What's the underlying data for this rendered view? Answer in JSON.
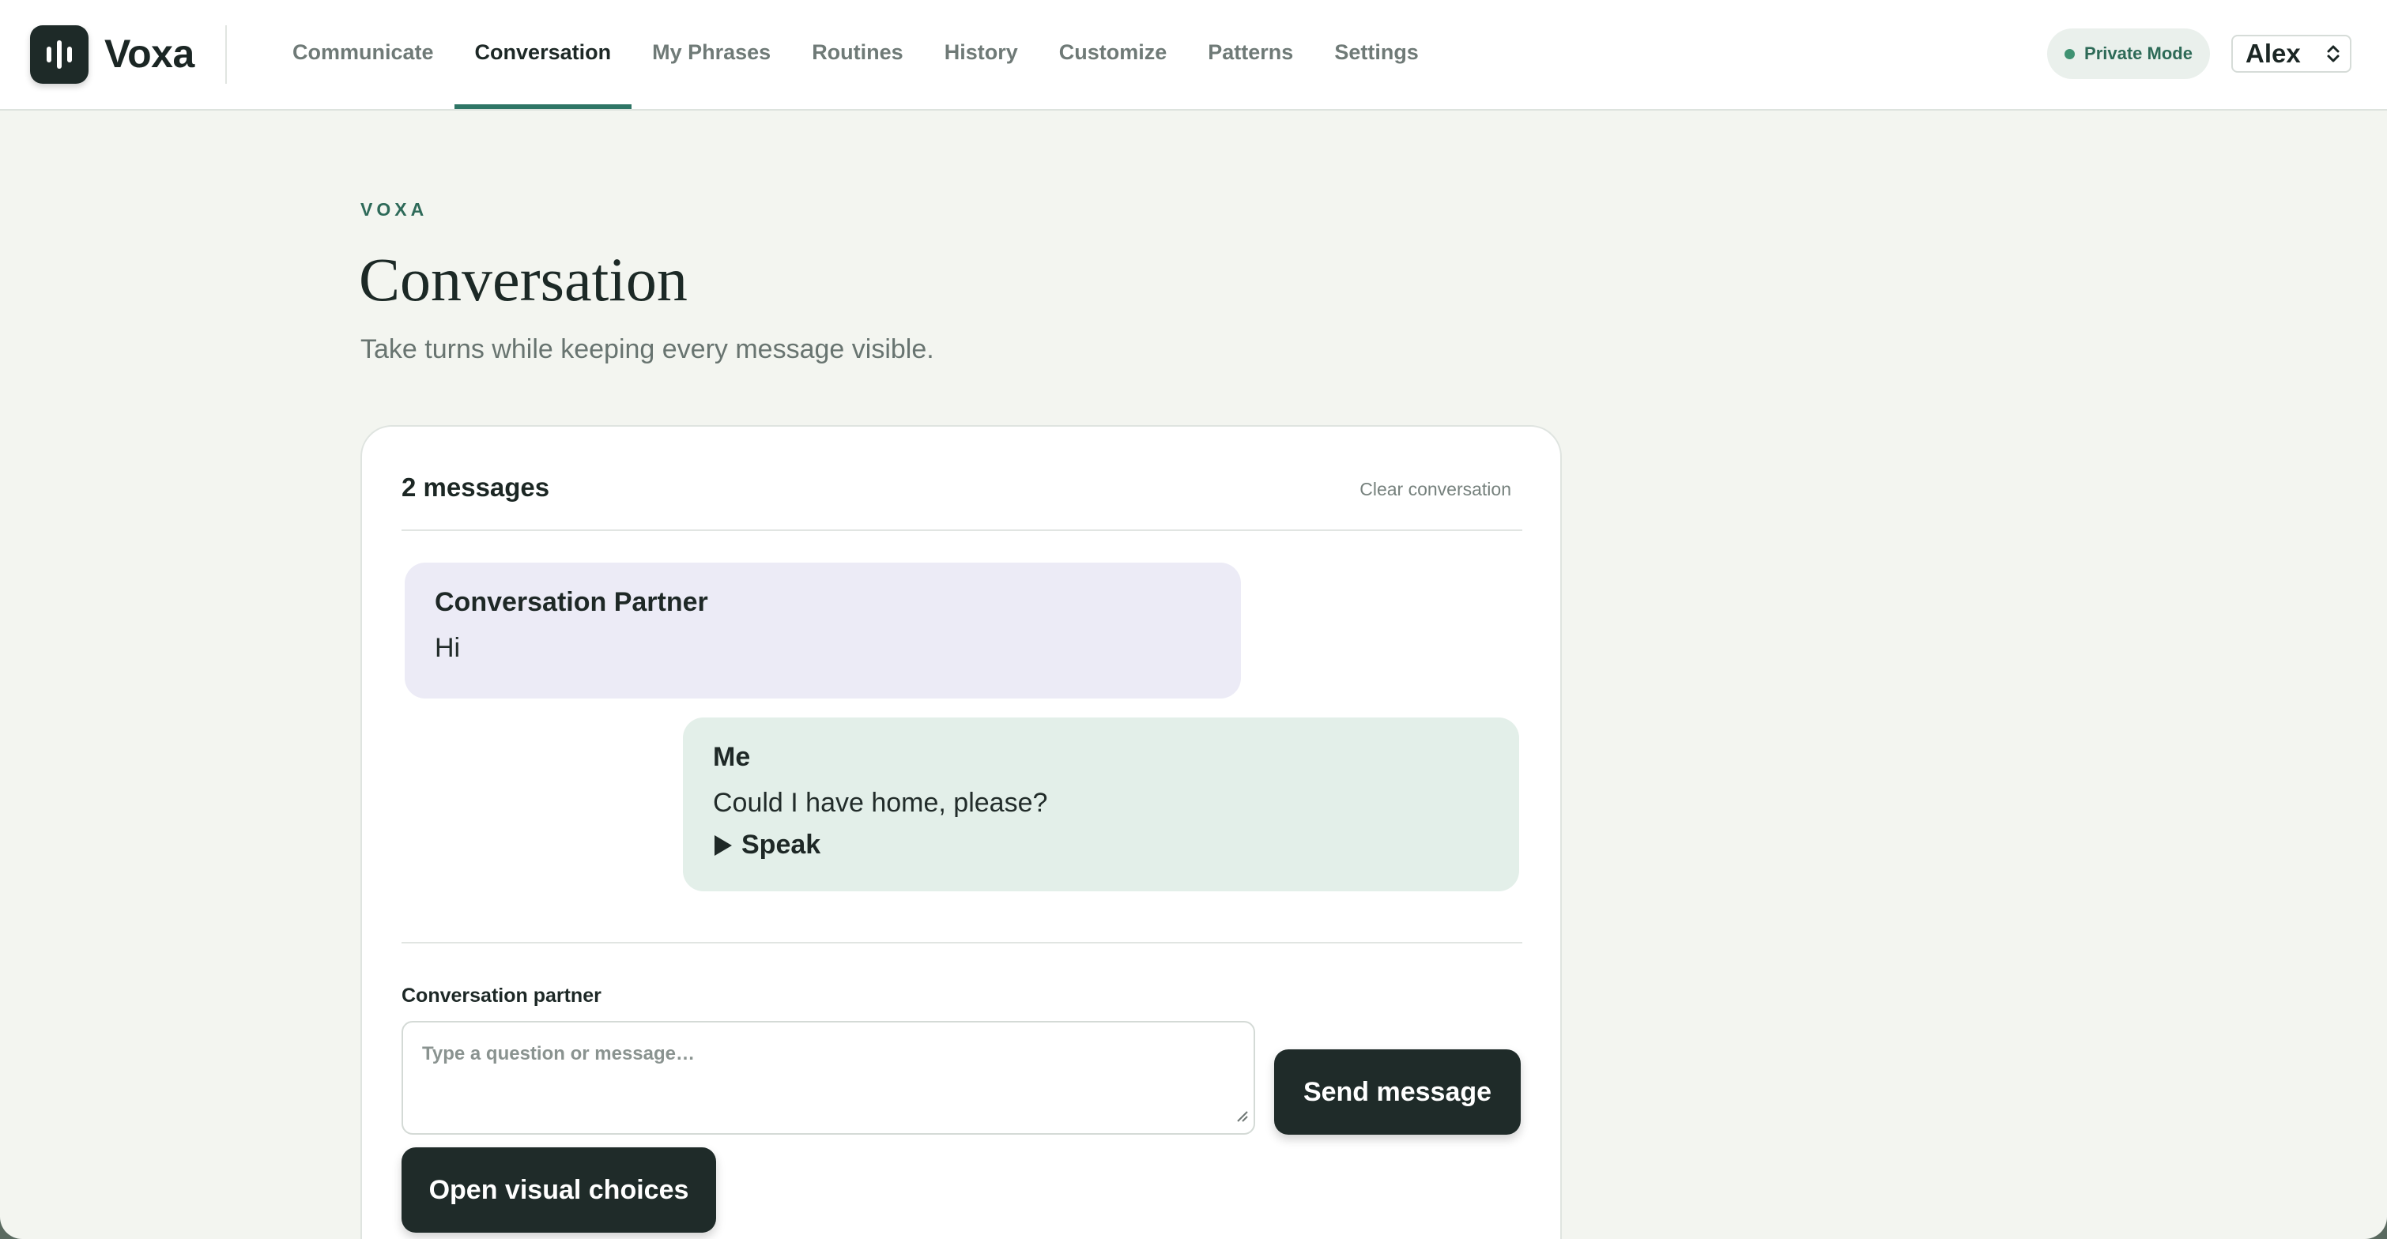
{
  "app": {
    "brand": "Voxa",
    "private_mode_label": "Private Mode",
    "user": "Alex"
  },
  "nav": {
    "items": [
      {
        "label": "Communicate",
        "active": false
      },
      {
        "label": "Conversation",
        "active": true
      },
      {
        "label": "My Phrases",
        "active": false
      },
      {
        "label": "Routines",
        "active": false
      },
      {
        "label": "History",
        "active": false
      },
      {
        "label": "Customize",
        "active": false
      },
      {
        "label": "Patterns",
        "active": false
      },
      {
        "label": "Settings",
        "active": false
      }
    ]
  },
  "header": {
    "eyebrow": "VOXA",
    "title": "Conversation",
    "subtitle": "Take turns while keeping every message visible."
  },
  "conversation": {
    "count_label": "2 messages",
    "clear_label": "Clear conversation",
    "messages": [
      {
        "speaker": "Conversation Partner",
        "text": "Hi"
      },
      {
        "speaker": "Me",
        "text": "Could I have home, please?",
        "speak_label": "Speak"
      }
    ]
  },
  "composer": {
    "label": "Conversation partner",
    "placeholder": "Type a question or message…",
    "send_label": "Send message",
    "visual_choices_label": "Open visual choices"
  },
  "colors": {
    "accent": "#2e7565",
    "dark_button": "#1f2b29",
    "partner_bubble": "#ecebf6",
    "me_bubble": "#e3efe9",
    "background": "#f3f5f0"
  },
  "icons": {
    "logo": "voice-bars-icon",
    "status": "status-dot-icon",
    "user_select": "chevron-updown-icon",
    "speak": "play-icon",
    "resize": "resize-grip-icon"
  }
}
